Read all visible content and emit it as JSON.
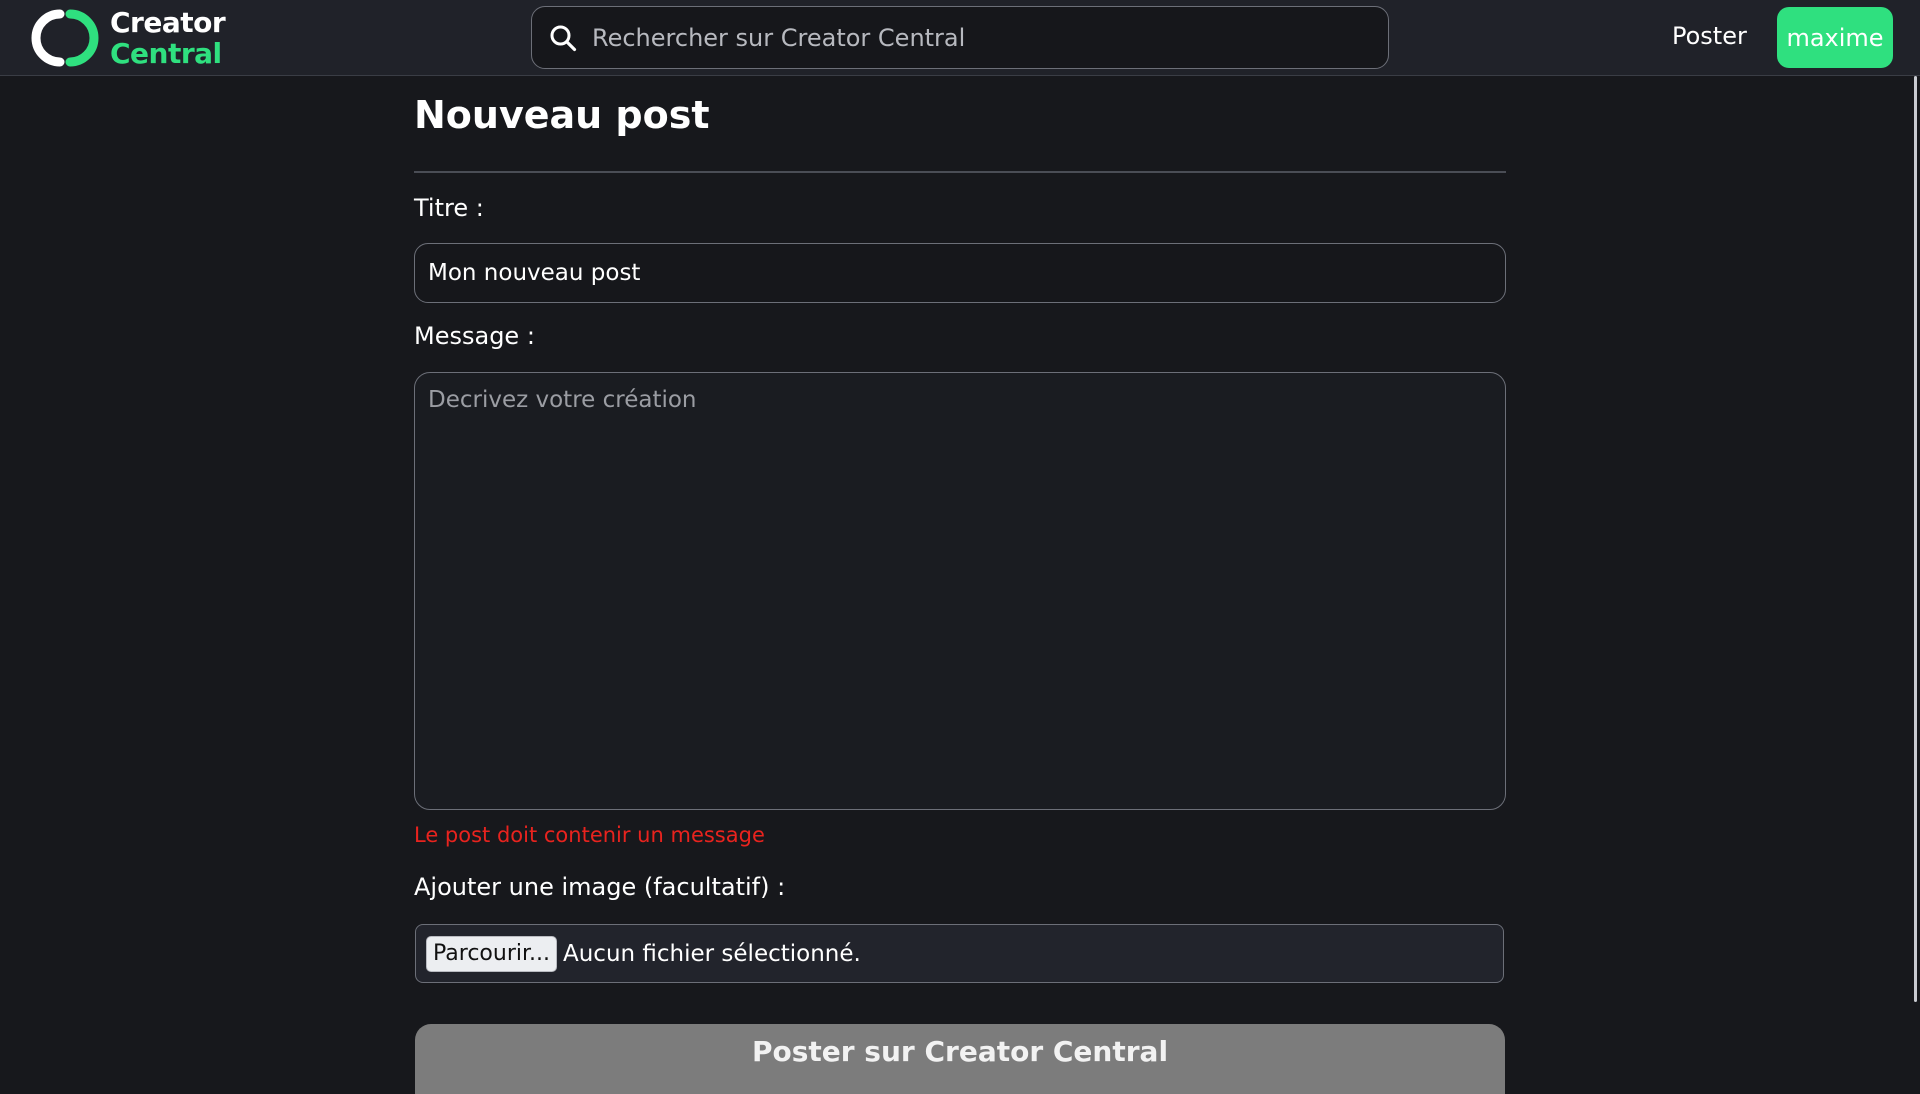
{
  "brand": {
    "line1": "Creator",
    "line2": "Central",
    "colors": {
      "accent": "#2fe07f",
      "background": "#17181c",
      "header": "#202229",
      "error": "#e8231e",
      "submit_disabled": "#7c7c7c"
    }
  },
  "header": {
    "search_placeholder": "Rechercher sur Creator Central",
    "search_icon": "search-icon",
    "nav_post_label": "Poster",
    "user_label": "maxime"
  },
  "form": {
    "page_title": "Nouveau post",
    "title_label": "Titre :",
    "title_value": "Mon nouveau post",
    "message_label": "Message :",
    "message_placeholder": "Decrivez votre création",
    "message_value": "",
    "error_message": "Le post doit contenir un message",
    "image_label": "Ajouter une image (facultatif) :",
    "browse_label": "Parcourir...",
    "file_status": "Aucun fichier sélectionné.",
    "submit_label": "Poster sur Creator Central"
  }
}
